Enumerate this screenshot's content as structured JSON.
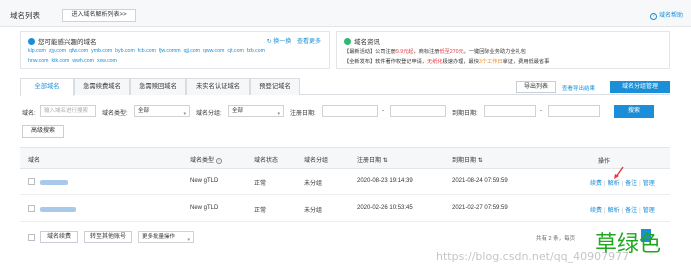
{
  "header": {
    "title": "域名列表",
    "parse_list_button": "进入域名解析列表>>",
    "help_link": "域名帮助"
  },
  "interest_card": {
    "title": "您可能感兴趣的域名",
    "refresh": "换一换",
    "more": "查看更多",
    "domains_row1": [
      "klp.com",
      "zjy.com",
      "qfw.com",
      "ymb.com",
      "byb.com",
      "fcb.com",
      "fjw.comm",
      "qjj.com",
      "qww.com",
      "cjt.com",
      "fzb.com"
    ],
    "domains_row2": [
      "hnw.com",
      "ktk.com",
      "wwh.com",
      "xxw.com"
    ]
  },
  "news_card": {
    "title": "域名资讯",
    "line1_prefix": "【最新活动】公司注册",
    "line1_price1": "9.9元起",
    "line1_mid": "，商标注册",
    "line1_price2": "低至270元",
    "line1_suffix": "，一键回际业务助力全礼包",
    "line2_prefix": "【全新发布】软件著作权登记申请，",
    "line2_highlight1": "无纸化",
    "line2_mid": "极速办理，最快",
    "line2_highlight2": "3个工作日",
    "line2_suffix": "拿证，费用低最省事"
  },
  "tabs": [
    "全部域名",
    "急需续费域名",
    "急需赎回域名",
    "未实名认证域名",
    "预登记域名"
  ],
  "actions": {
    "export_list": "导出列表",
    "view_export_results": "查看导出结果",
    "manage_groups": "域名分组管理"
  },
  "filters": {
    "domain_label": "域名:",
    "domain_placeholder": "输入域名进行搜索",
    "type_label": "域名类型:",
    "type_value": "全部",
    "group_label": "域名分组:",
    "group_value": "全部",
    "reg_date_label": "注册日期:",
    "range_sep": "-",
    "expire_date_label": "到期日期:",
    "search_button": "搜索",
    "advanced_button": "高级搜索"
  },
  "table": {
    "headers": [
      "域名",
      "域名类型",
      "域名状态",
      "域名分组",
      "注册日期",
      "到期日期",
      "操作"
    ],
    "rows": [
      {
        "type": "New gTLD",
        "status": "正常",
        "group": "未分组",
        "reg_date": "2020-08-23 19:14:39",
        "expire_date": "2021-08-24 07:59:59",
        "ops": [
          "续费",
          "解析",
          "备注",
          "管理"
        ]
      },
      {
        "type": "New gTLD",
        "status": "正常",
        "group": "未分组",
        "reg_date": "2020-02-26 10:53:45",
        "expire_date": "2021-02-27 07:59:59",
        "ops": [
          "续费",
          "解析",
          "备注",
          "管理"
        ]
      }
    ]
  },
  "footer": {
    "renew_button": "域名续费",
    "transfer_button": "转至其他账号",
    "batch_select": "更多批量操作",
    "pagination_text": "共有 2 条，每页"
  },
  "overlay": {
    "watermark_text": "草绿色",
    "url_watermark": "https://blog.csdn.net/qq_40907977"
  },
  "colors": {
    "accent": "#1a8fd8",
    "warning": "#e4393c",
    "watermark": "#1fa81f"
  }
}
